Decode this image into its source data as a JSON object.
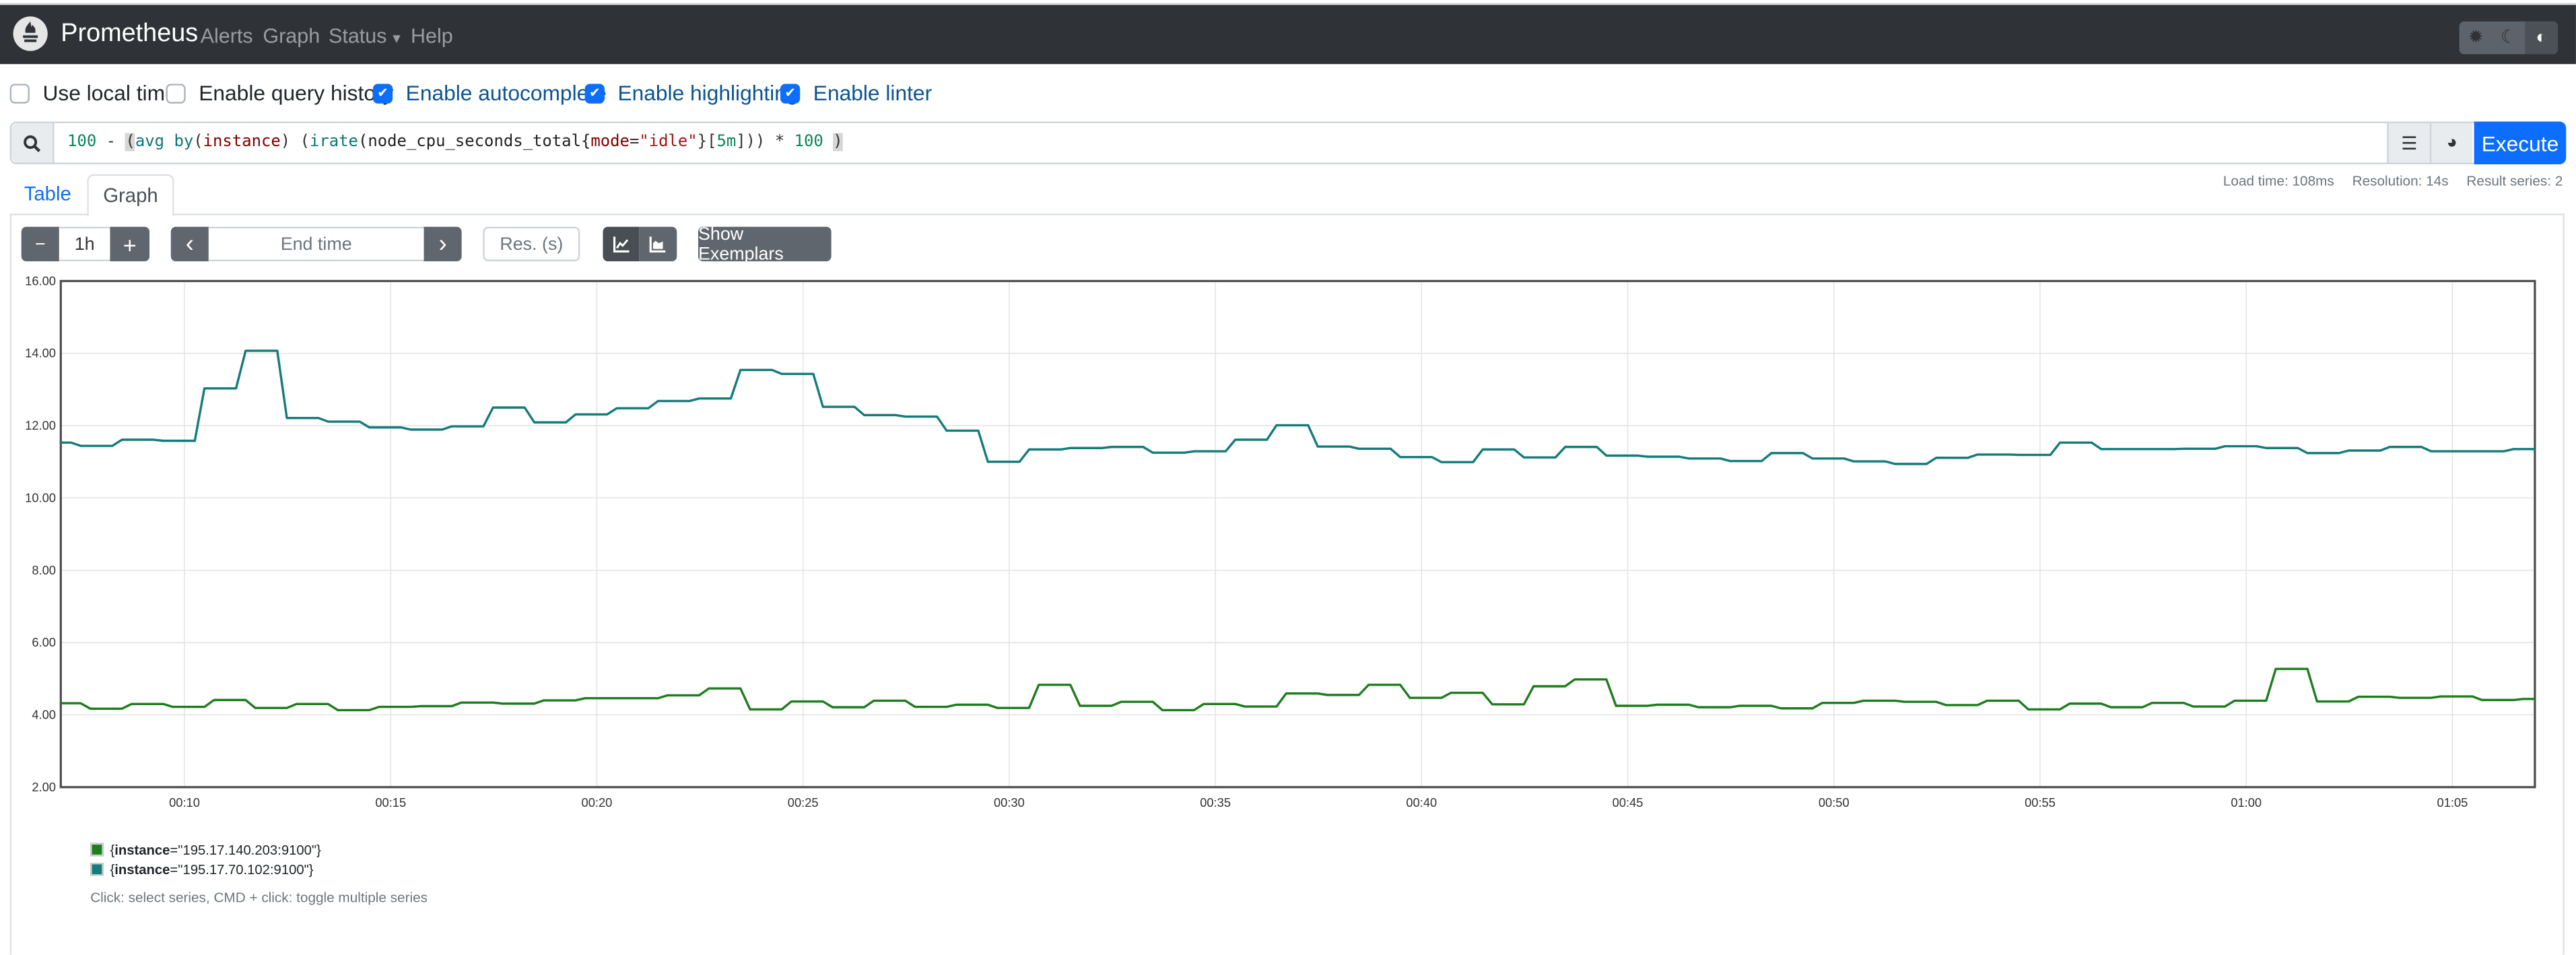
{
  "navbar": {
    "brand": "Prometheus",
    "links": [
      "Alerts",
      "Graph",
      "Status",
      "Help"
    ],
    "status_has_dropdown": true,
    "theme_icons": [
      "sun-icon",
      "moon-icon",
      "contrast-icon"
    ],
    "active_theme": "contrast-icon"
  },
  "options": [
    {
      "label": "Use local time",
      "checked": false
    },
    {
      "label": "Enable query history",
      "checked": false
    },
    {
      "label": "Enable autocomplete",
      "checked": true
    },
    {
      "label": "Enable highlighting",
      "checked": true
    },
    {
      "label": "Enable linter",
      "checked": true
    }
  ],
  "query": {
    "value": "100 - (avg by(instance) (irate(node_cpu_seconds_total{mode=\"idle\"}[5m])) * 100 )",
    "tokens": [
      {
        "t": "100",
        "c": "#098658"
      },
      {
        "t": " - ",
        "c": "#333333"
      },
      {
        "t": "(",
        "c": "#333333",
        "hl": true
      },
      {
        "t": "avg",
        "c": "#0e7575"
      },
      {
        "t": " ",
        "c": "#333333"
      },
      {
        "t": "by",
        "c": "#0e7575"
      },
      {
        "t": "(",
        "c": "#333333"
      },
      {
        "t": "instance",
        "c": "#800000"
      },
      {
        "t": ") (",
        "c": "#333333"
      },
      {
        "t": "irate",
        "c": "#0e7575"
      },
      {
        "t": "(node_cpu_seconds_total{",
        "c": "#222222"
      },
      {
        "t": "mode",
        "c": "#800000"
      },
      {
        "t": "=",
        "c": "#333333"
      },
      {
        "t": "\"idle\"",
        "c": "#a31515"
      },
      {
        "t": "}[",
        "c": "#333333"
      },
      {
        "t": "5m",
        "c": "#098658"
      },
      {
        "t": "])) * ",
        "c": "#333333"
      },
      {
        "t": "100",
        "c": "#098658"
      },
      {
        "t": " ",
        "c": "#333333"
      },
      {
        "t": ")",
        "c": "#333333",
        "hl": true
      }
    ],
    "execute_label": "Execute",
    "accent": "#0d6efd"
  },
  "stats": {
    "load_time": "Load time: 108ms",
    "resolution": "Resolution: 14s",
    "result_series": "Result series: 2"
  },
  "tabs": [
    {
      "label": "Table",
      "active": false
    },
    {
      "label": "Graph",
      "active": true
    }
  ],
  "graph_controls": {
    "minus": "−",
    "range": "1h",
    "plus": "+",
    "prev": "‹",
    "end_time_placeholder": "End time",
    "next": "›",
    "res_placeholder": "Res. (s)",
    "show_exemplars": "Show Exemplars",
    "mode": "line"
  },
  "chart_data": {
    "type": "line",
    "xlim": [
      "00:07:00",
      "01:07:00"
    ],
    "ylim": [
      2,
      16
    ],
    "yticks": [
      "2.00",
      "4.00",
      "6.00",
      "8.00",
      "10.00",
      "12.00",
      "14.00",
      "16.00"
    ],
    "xticks": [
      "00:10",
      "00:15",
      "00:20",
      "00:25",
      "00:30",
      "00:35",
      "00:40",
      "00:45",
      "00:50",
      "00:55",
      "01:00",
      "01:05"
    ],
    "grid": true,
    "series": [
      {
        "name": "{instance=\"195.17.140.203:9100\"}",
        "color": "#1e7d1e",
        "points": [
          [
            "00:07:00",
            4.32
          ],
          [
            "00:07:43",
            4.17
          ],
          [
            "00:08:43",
            4.3
          ],
          [
            "00:09:43",
            4.22
          ],
          [
            "00:10:43",
            4.41
          ],
          [
            "00:11:43",
            4.19
          ],
          [
            "00:12:43",
            4.3
          ],
          [
            "00:13:43",
            4.13
          ],
          [
            "00:14:43",
            4.22
          ],
          [
            "00:15:43",
            4.24
          ],
          [
            "00:16:43",
            4.34
          ],
          [
            "00:17:43",
            4.31
          ],
          [
            "00:18:43",
            4.4
          ],
          [
            "00:19:43",
            4.46
          ],
          [
            "00:20:43",
            4.46
          ],
          [
            "00:21:43",
            4.54
          ],
          [
            "00:22:43",
            4.73
          ],
          [
            "00:23:43",
            4.15
          ],
          [
            "00:24:43",
            4.37
          ],
          [
            "00:25:43",
            4.21
          ],
          [
            "00:26:43",
            4.39
          ],
          [
            "00:27:43",
            4.22
          ],
          [
            "00:28:43",
            4.28
          ],
          [
            "00:29:43",
            4.19
          ],
          [
            "00:30:43",
            4.83
          ],
          [
            "00:31:43",
            4.25
          ],
          [
            "00:32:43",
            4.36
          ],
          [
            "00:33:43",
            4.13
          ],
          [
            "00:34:43",
            4.3
          ],
          [
            "00:35:43",
            4.23
          ],
          [
            "00:36:43",
            4.59
          ],
          [
            "00:37:43",
            4.55
          ],
          [
            "00:38:43",
            4.83
          ],
          [
            "00:39:43",
            4.47
          ],
          [
            "00:40:43",
            4.61
          ],
          [
            "00:41:43",
            4.29
          ],
          [
            "00:42:43",
            4.79
          ],
          [
            "00:43:43",
            4.98
          ],
          [
            "00:44:43",
            4.25
          ],
          [
            "00:45:43",
            4.28
          ],
          [
            "00:46:43",
            4.21
          ],
          [
            "00:47:43",
            4.25
          ],
          [
            "00:48:43",
            4.18
          ],
          [
            "00:49:43",
            4.33
          ],
          [
            "00:50:43",
            4.39
          ],
          [
            "00:51:43",
            4.36
          ],
          [
            "00:52:43",
            4.27
          ],
          [
            "00:53:43",
            4.39
          ],
          [
            "00:54:43",
            4.15
          ],
          [
            "00:55:43",
            4.31
          ],
          [
            "00:56:43",
            4.21
          ],
          [
            "00:57:43",
            4.33
          ],
          [
            "00:58:43",
            4.23
          ],
          [
            "00:59:43",
            4.39
          ],
          [
            "01:00:43",
            5.27
          ],
          [
            "01:01:43",
            4.37
          ],
          [
            "01:02:43",
            4.5
          ],
          [
            "01:03:43",
            4.47
          ],
          [
            "01:04:43",
            4.51
          ],
          [
            "01:05:43",
            4.41
          ],
          [
            "01:06:43",
            4.44
          ]
        ]
      },
      {
        "name": "{instance=\"195.17.70.102:9100\"}",
        "color": "#157b7b",
        "points": [
          [
            "00:07:00",
            11.53
          ],
          [
            "00:07:29",
            11.44
          ],
          [
            "00:08:29",
            11.61
          ],
          [
            "00:09:29",
            11.58
          ],
          [
            "00:10:29",
            13.03
          ],
          [
            "00:11:29",
            14.07
          ],
          [
            "00:12:29",
            12.21
          ],
          [
            "00:13:29",
            12.11
          ],
          [
            "00:14:29",
            11.95
          ],
          [
            "00:15:29",
            11.89
          ],
          [
            "00:16:29",
            11.98
          ],
          [
            "00:17:29",
            12.5
          ],
          [
            "00:18:29",
            12.09
          ],
          [
            "00:19:29",
            12.31
          ],
          [
            "00:20:29",
            12.48
          ],
          [
            "00:21:29",
            12.68
          ],
          [
            "00:22:29",
            12.75
          ],
          [
            "00:23:29",
            13.54
          ],
          [
            "00:24:29",
            13.43
          ],
          [
            "00:25:29",
            12.52
          ],
          [
            "00:26:29",
            12.29
          ],
          [
            "00:27:29",
            12.25
          ],
          [
            "00:28:29",
            11.86
          ],
          [
            "00:29:29",
            11.0
          ],
          [
            "00:30:29",
            11.34
          ],
          [
            "00:31:29",
            11.38
          ],
          [
            "00:32:29",
            11.41
          ],
          [
            "00:33:29",
            11.25
          ],
          [
            "00:34:29",
            11.29
          ],
          [
            "00:35:29",
            11.61
          ],
          [
            "00:36:29",
            12.01
          ],
          [
            "00:37:29",
            11.42
          ],
          [
            "00:38:29",
            11.36
          ],
          [
            "00:39:29",
            11.13
          ],
          [
            "00:40:29",
            10.99
          ],
          [
            "00:41:29",
            11.34
          ],
          [
            "00:42:29",
            11.12
          ],
          [
            "00:43:29",
            11.41
          ],
          [
            "00:44:29",
            11.17
          ],
          [
            "00:45:29",
            11.14
          ],
          [
            "00:46:29",
            11.09
          ],
          [
            "00:47:29",
            11.02
          ],
          [
            "00:48:29",
            11.24
          ],
          [
            "00:49:29",
            11.09
          ],
          [
            "00:50:29",
            11.01
          ],
          [
            "00:51:29",
            10.94
          ],
          [
            "00:52:29",
            11.11
          ],
          [
            "00:53:29",
            11.2
          ],
          [
            "00:54:29",
            11.19
          ],
          [
            "00:55:29",
            11.53
          ],
          [
            "00:56:29",
            11.35
          ],
          [
            "00:57:29",
            11.35
          ],
          [
            "00:58:29",
            11.36
          ],
          [
            "00:59:29",
            11.43
          ],
          [
            "01:00:29",
            11.38
          ],
          [
            "01:01:29",
            11.24
          ],
          [
            "01:02:29",
            11.31
          ],
          [
            "01:03:29",
            11.41
          ],
          [
            "01:04:29",
            11.29
          ],
          [
            "01:05:29",
            11.29
          ],
          [
            "01:06:29",
            11.35
          ]
        ]
      }
    ],
    "legend_placement": "bottom-left"
  },
  "legend": {
    "items": [
      {
        "label_name": "instance",
        "label_value": "\"195.17.140.203:9100\"",
        "color": "#1e7d1e"
      },
      {
        "label_name": "instance",
        "label_value": "\"195.17.70.102:9100\"",
        "color": "#157b7b"
      }
    ],
    "help": "Click: select series, CMD + click: toggle multiple series"
  }
}
